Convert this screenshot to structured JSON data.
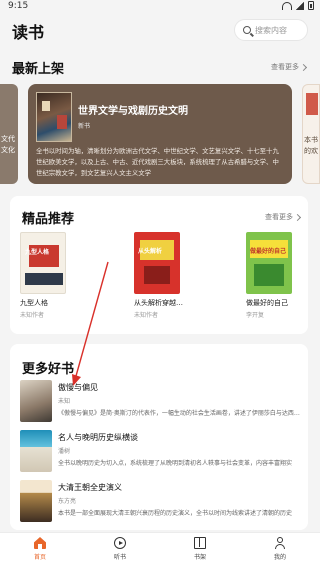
{
  "status_bar": {
    "time": "9:15"
  },
  "header": {
    "title": "读书",
    "search_placeholder": "搜索内容"
  },
  "new_shelf": {
    "title": "最新上架",
    "see_more": "查看更多",
    "left_peek_text": "文代文化",
    "right_peek_text": "本书的欢",
    "featured": {
      "title": "世界文学与戏剧历史文明",
      "tag": "新书",
      "description": "全书以时间为轴，清晰划分为欧洲古代文学、中世纪文学、文艺复兴文学、十七至十九世纪欧美文学，以及上古、中古、近代戏剧三大板块，系统梳理了从古希腊与文学、中世纪宗教文学，到文艺复兴人文主义文学"
    }
  },
  "premium": {
    "title": "精品推荐",
    "see_more": "查看更多",
    "books": [
      {
        "name": "九型人格",
        "author": "未知作者",
        "cover_text": "九型人格"
      },
      {
        "name": "从头解析穿越…",
        "author": "未知作者",
        "cover_text": "从头解析"
      },
      {
        "name": "做最好的自己",
        "author": "李开复",
        "cover_text": "做最好的自己"
      }
    ]
  },
  "more_books": {
    "title": "更多好书",
    "items": [
      {
        "title": "傲慢与偏见",
        "author": "未知",
        "description": "《傲慢与偏见》是简·奥斯汀的代表作，一幅生动的社会生活画卷，讲述了伊丽莎白与达西之间的爱情故事"
      },
      {
        "title": "名人与晚明历史纵横谈",
        "author": "潘树",
        "description": "全书以晚明历史为切入点，系统梳理了从晚明到清初名人轶事与社会变革，内容丰富翔实"
      },
      {
        "title": "大清王朝全史演义",
        "author": "东方亮",
        "description": "本书是一部全面展现大清王朝兴衰历程的历史演义，全书以时间为线索讲述了清朝的历史"
      }
    ]
  },
  "tabbar": {
    "items": [
      {
        "label": "首页",
        "icon": "home-icon",
        "active": true
      },
      {
        "label": "听书",
        "icon": "play-icon",
        "active": false
      },
      {
        "label": "书架",
        "icon": "book-icon",
        "active": false
      },
      {
        "label": "我的",
        "icon": "user-icon",
        "active": false
      }
    ]
  },
  "colors": {
    "accent": "#e8662a",
    "featured_bg": "#6e5a4b",
    "annotation": "#d9302a"
  }
}
